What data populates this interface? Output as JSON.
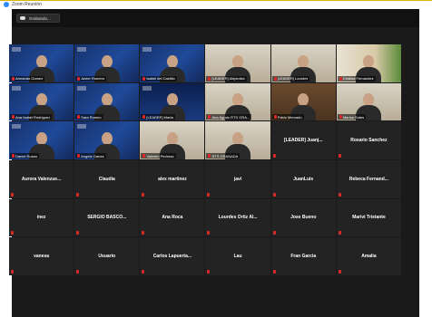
{
  "window": {
    "title": "Zoom Reunión"
  },
  "toolbar": {
    "recording_label": "Grabando..."
  },
  "colors": {
    "muted_mic": "#e02828",
    "zoom_blue": "#2d8cff"
  },
  "video_participants": [
    {
      "name": "Armando Gomez",
      "muted": true
    },
    {
      "name": "Javier Romero",
      "muted": true
    },
    {
      "name": "Isabel del Castillo",
      "muted": true
    },
    {
      "name": "[LEADER] Alejandra",
      "muted": true
    },
    {
      "name": "[LEADER] Lourdes",
      "muted": true
    },
    {
      "name": "Cristina Fernandez",
      "muted": true
    },
    {
      "name": "Ana Isabel Rodriguez",
      "muted": true
    },
    {
      "name": "Sara Romeo",
      "muted": true
    },
    {
      "name": "[LEADER] Marta",
      "muted": true
    },
    {
      "name": "Ana Agudo RTS GRA...",
      "muted": true
    },
    {
      "name": "Pablo Mercado",
      "muted": true
    },
    {
      "name": "Marisa Sotes",
      "muted": true
    },
    {
      "name": "Daniel Ruano",
      "muted": true
    },
    {
      "name": "Angela Garcia",
      "muted": true
    },
    {
      "name": "Valentin Pedrosa",
      "muted": true
    },
    {
      "name": "RTS GRANADA",
      "muted": true
    }
  ],
  "name_participants": [
    {
      "name": "[LEADER] Juanj...",
      "muted": true
    },
    {
      "name": "Rosario Sanchez",
      "muted": true
    },
    {
      "name": "Aurora Valenzue...",
      "muted": true
    },
    {
      "name": "Claudia",
      "muted": true
    },
    {
      "name": "alex martinez",
      "muted": true
    },
    {
      "name": "javi",
      "muted": true
    },
    {
      "name": "JuanLuis",
      "muted": true
    },
    {
      "name": "Rebeca Fernand...",
      "muted": true
    },
    {
      "name": "inez",
      "muted": true
    },
    {
      "name": "SERGIO BASCO...",
      "muted": true
    },
    {
      "name": "Ana Roca",
      "muted": true
    },
    {
      "name": "Lourdes Ortiz Al...",
      "muted": true
    },
    {
      "name": "Jose Bueno",
      "muted": true
    },
    {
      "name": "Marivi Tristante",
      "muted": true
    },
    {
      "name": "vanesa",
      "muted": true
    },
    {
      "name": "Usuario",
      "muted": true
    },
    {
      "name": "Carlos Lapuerta...",
      "muted": true
    },
    {
      "name": "Lau",
      "muted": true
    },
    {
      "name": "Fran Garcia",
      "muted": true
    },
    {
      "name": "Amalia",
      "muted": true
    }
  ]
}
